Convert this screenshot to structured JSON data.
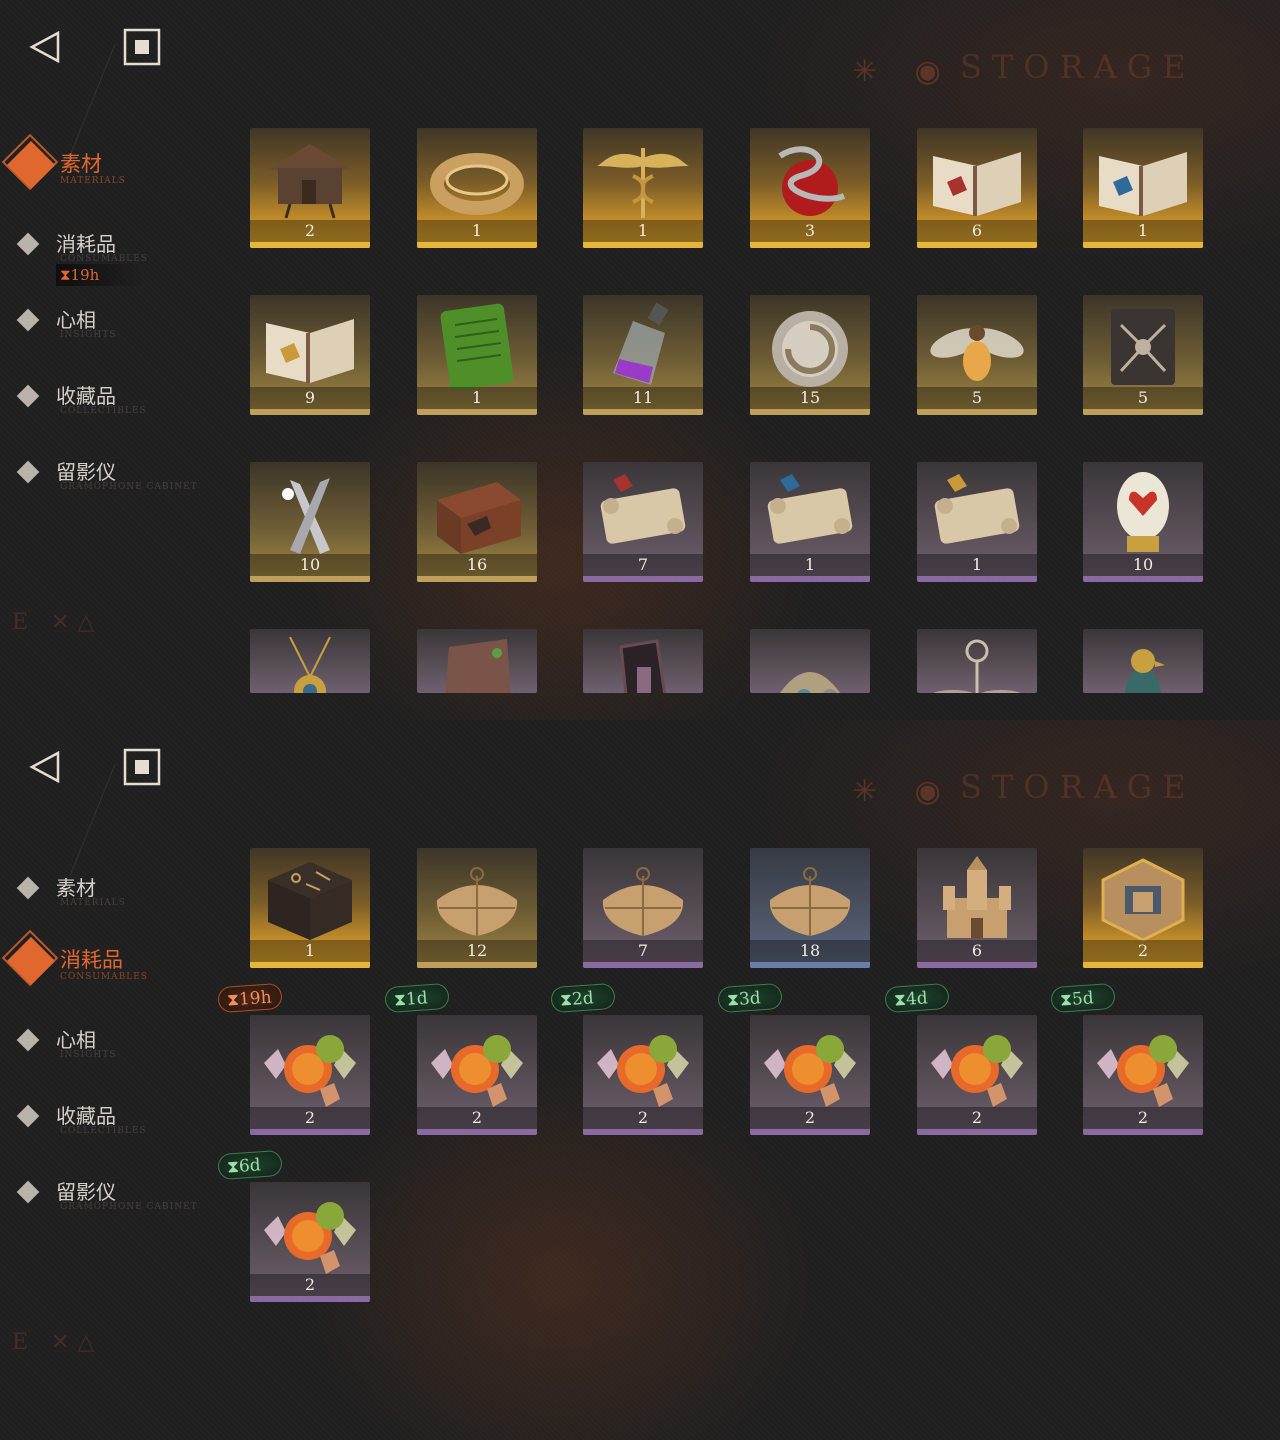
{
  "header": {
    "back_icon": "back-triangle-icon",
    "home_icon": "home-square-icon",
    "title_deco": "STORAGE",
    "deco_icons": "✳ ◉"
  },
  "footer_deco": "E ✕△",
  "panel1": {
    "nav": [
      {
        "label": "素材",
        "sub": "MATERIALS",
        "active": true
      },
      {
        "label": "消耗品",
        "sub": "CONSUMABLES",
        "active": false
      },
      {
        "label": "心相",
        "sub": "INSIGHTS",
        "active": false
      },
      {
        "label": "收藏品",
        "sub": "COLLECTIBLES",
        "active": false
      },
      {
        "label": "留影仪",
        "sub": "GRAMOPHONE CABINET",
        "active": false
      }
    ],
    "timer": "⧗19h",
    "items": [
      {
        "count": "2",
        "icon": "hut-icon",
        "tier": "gold"
      },
      {
        "count": "1",
        "icon": "gold-ring-icon",
        "tier": "gold"
      },
      {
        "count": "1",
        "icon": "caduceus-icon",
        "tier": "gold"
      },
      {
        "count": "3",
        "icon": "apple-snake-icon",
        "tier": "gold"
      },
      {
        "count": "6",
        "icon": "book-red-icon",
        "tier": "gold"
      },
      {
        "count": "1",
        "icon": "book-blue-icon",
        "tier": "gold"
      },
      {
        "count": "9",
        "icon": "book-gold-icon",
        "tier": "gold-dim"
      },
      {
        "count": "1",
        "icon": "green-tablet-icon",
        "tier": "gold-dim"
      },
      {
        "count": "11",
        "icon": "purple-bottle-icon",
        "tier": "gold-dim"
      },
      {
        "count": "15",
        "icon": "silver-device-icon",
        "tier": "gold-dim"
      },
      {
        "count": "5",
        "icon": "firefly-icon",
        "tier": "gold-dim"
      },
      {
        "count": "5",
        "icon": "dark-book-icon",
        "tier": "gold-dim"
      },
      {
        "count": "10",
        "icon": "silver-bullets-icon",
        "tier": "gold-dim"
      },
      {
        "count": "16",
        "icon": "hand-box-icon",
        "tier": "gold-dim"
      },
      {
        "count": "7",
        "icon": "scroll-red-icon",
        "tier": "purple"
      },
      {
        "count": "1",
        "icon": "scroll-blue-icon",
        "tier": "purple"
      },
      {
        "count": "1",
        "icon": "scroll-gold-icon",
        "tier": "purple"
      },
      {
        "count": "10",
        "icon": "jeweled-egg-icon",
        "tier": "purple"
      }
    ],
    "partial_items": [
      {
        "icon": "amulet-icon"
      },
      {
        "icon": "stone-fragment-icon"
      },
      {
        "icon": "frame-icon"
      },
      {
        "icon": "mask-icon"
      },
      {
        "icon": "winged-key-icon"
      },
      {
        "icon": "bird-figure-icon"
      }
    ]
  },
  "panel2": {
    "nav": [
      {
        "label": "素材",
        "sub": "MATERIALS",
        "active": false
      },
      {
        "label": "消耗品",
        "sub": "CONSUMABLES",
        "active": true
      },
      {
        "label": "心相",
        "sub": "INSIGHTS",
        "active": false
      },
      {
        "label": "收藏品",
        "sub": "COLLECTIBLES",
        "active": false
      },
      {
        "label": "留影仪",
        "sub": "GRAMOPHONE CABINET",
        "active": false
      }
    ],
    "items": [
      {
        "count": "1",
        "icon": "rune-box-icon",
        "tier": "gold"
      },
      {
        "count": "12",
        "icon": "parcel-icon",
        "tier": "gold-dim"
      },
      {
        "count": "7",
        "icon": "parcel-icon",
        "tier": "purple"
      },
      {
        "count": "18",
        "icon": "parcel-icon",
        "tier": "blue"
      },
      {
        "count": "6",
        "icon": "sand-castle-icon",
        "tier": "purple"
      },
      {
        "count": "2",
        "icon": "hex-token-icon",
        "tier": "gold"
      }
    ],
    "candies": [
      {
        "count": "2",
        "timer": "⧗19h",
        "tone": "orange"
      },
      {
        "count": "2",
        "timer": "⧗1d",
        "tone": "green"
      },
      {
        "count": "2",
        "timer": "⧗2d",
        "tone": "green"
      },
      {
        "count": "2",
        "timer": "⧗3d",
        "tone": "green"
      },
      {
        "count": "2",
        "timer": "⧗4d",
        "tone": "green"
      },
      {
        "count": "2",
        "timer": "⧗5d",
        "tone": "green"
      },
      {
        "count": "2",
        "timer": "⧗6d",
        "tone": "green"
      }
    ]
  },
  "colors": {
    "accent": "#e0672e",
    "gold": "#e8b53b",
    "purple": "#8a6aa0",
    "blue": "#6a7fa8"
  }
}
